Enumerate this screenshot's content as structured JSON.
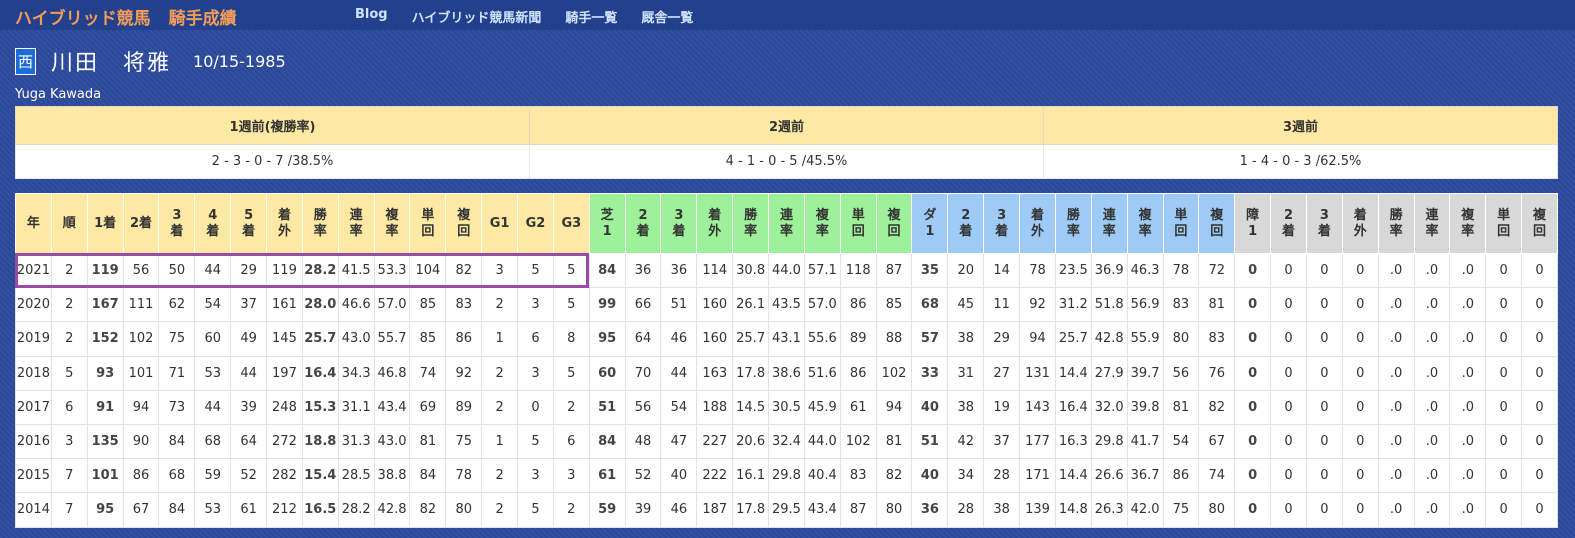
{
  "header": {
    "brand": "ハイブリッド競馬",
    "brand_sub": "騎手成績",
    "nav": [
      "Blog",
      "ハイブリッド競馬新聞",
      "騎手一覧",
      "厩舎一覧"
    ]
  },
  "jockey": {
    "region": "西",
    "name": "川田　将雅",
    "birth": "10/15-1985",
    "roman": "Yuga Kawada"
  },
  "weekly": {
    "headers": [
      "1週前(複勝率)",
      "2週前",
      "3週前"
    ],
    "values": [
      "2 - 3 - 0 - 7 /38.5%",
      "4 - 1 - 0 - 5 /45.5%",
      "1 - 4 - 0 - 3 /62.5%"
    ]
  },
  "stats": {
    "columns": [
      [
        "年",
        "",
        "y"
      ],
      [
        "順",
        "",
        "y"
      ],
      [
        "1着",
        "",
        "y"
      ],
      [
        "2着",
        "",
        "y"
      ],
      [
        "3",
        "着",
        "y"
      ],
      [
        "4",
        "着",
        "y"
      ],
      [
        "5",
        "着",
        "y"
      ],
      [
        "着",
        "外",
        "y"
      ],
      [
        "勝",
        "率",
        "y"
      ],
      [
        "連",
        "率",
        "y"
      ],
      [
        "複",
        "率",
        "y"
      ],
      [
        "単",
        "回",
        "y"
      ],
      [
        "複",
        "回",
        "y"
      ],
      [
        "G1",
        "",
        "y"
      ],
      [
        "G2",
        "",
        "y"
      ],
      [
        "G3",
        "",
        "y"
      ],
      [
        "芝",
        "1",
        "g"
      ],
      [
        "2",
        "着",
        "g"
      ],
      [
        "3",
        "着",
        "g"
      ],
      [
        "着",
        "外",
        "g"
      ],
      [
        "勝",
        "率",
        "g"
      ],
      [
        "連",
        "率",
        "g"
      ],
      [
        "複",
        "率",
        "g"
      ],
      [
        "単",
        "回",
        "g"
      ],
      [
        "複",
        "回",
        "g"
      ],
      [
        "ダ",
        "1",
        "b"
      ],
      [
        "2",
        "着",
        "b"
      ],
      [
        "3",
        "着",
        "b"
      ],
      [
        "着",
        "外",
        "b"
      ],
      [
        "勝",
        "率",
        "b"
      ],
      [
        "連",
        "率",
        "b"
      ],
      [
        "複",
        "率",
        "b"
      ],
      [
        "単",
        "回",
        "b"
      ],
      [
        "複",
        "回",
        "b"
      ],
      [
        "障",
        "1",
        "gr"
      ],
      [
        "2",
        "着",
        "gr"
      ],
      [
        "3",
        "着",
        "gr"
      ],
      [
        "着",
        "外",
        "gr"
      ],
      [
        "勝",
        "率",
        "gr"
      ],
      [
        "連",
        "率",
        "gr"
      ],
      [
        "複",
        "率",
        "gr"
      ],
      [
        "単",
        "回",
        "gr"
      ],
      [
        "複",
        "回",
        "gr"
      ]
    ],
    "bold_cols": [
      2,
      8,
      16,
      25,
      34
    ],
    "rows": [
      [
        "2021",
        "2",
        "119",
        "56",
        "50",
        "44",
        "29",
        "119",
        "28.2",
        "41.5",
        "53.3",
        "104",
        "82",
        "3",
        "5",
        "5",
        "84",
        "36",
        "36",
        "114",
        "30.8",
        "44.0",
        "57.1",
        "118",
        "87",
        "35",
        "20",
        "14",
        "78",
        "23.5",
        "36.9",
        "46.3",
        "78",
        "72",
        "0",
        "0",
        "0",
        "0",
        ".0",
        ".0",
        ".0",
        "0",
        "0"
      ],
      [
        "2020",
        "2",
        "167",
        "111",
        "62",
        "54",
        "37",
        "161",
        "28.0",
        "46.6",
        "57.0",
        "85",
        "83",
        "2",
        "3",
        "5",
        "99",
        "66",
        "51",
        "160",
        "26.1",
        "43.5",
        "57.0",
        "86",
        "85",
        "68",
        "45",
        "11",
        "92",
        "31.2",
        "51.8",
        "56.9",
        "83",
        "81",
        "0",
        "0",
        "0",
        "0",
        ".0",
        ".0",
        ".0",
        "0",
        "0"
      ],
      [
        "2019",
        "2",
        "152",
        "102",
        "75",
        "60",
        "49",
        "145",
        "25.7",
        "43.0",
        "55.7",
        "85",
        "86",
        "1",
        "6",
        "8",
        "95",
        "64",
        "46",
        "160",
        "25.7",
        "43.1",
        "55.6",
        "89",
        "88",
        "57",
        "38",
        "29",
        "94",
        "25.7",
        "42.8",
        "55.9",
        "80",
        "83",
        "0",
        "0",
        "0",
        "0",
        ".0",
        ".0",
        ".0",
        "0",
        "0"
      ],
      [
        "2018",
        "5",
        "93",
        "101",
        "71",
        "53",
        "44",
        "197",
        "16.4",
        "34.3",
        "46.8",
        "74",
        "92",
        "2",
        "3",
        "5",
        "60",
        "70",
        "44",
        "163",
        "17.8",
        "38.6",
        "51.6",
        "86",
        "102",
        "33",
        "31",
        "27",
        "131",
        "14.4",
        "27.9",
        "39.7",
        "56",
        "76",
        "0",
        "0",
        "0",
        "0",
        ".0",
        ".0",
        ".0",
        "0",
        "0"
      ],
      [
        "2017",
        "6",
        "91",
        "94",
        "73",
        "44",
        "39",
        "248",
        "15.3",
        "31.1",
        "43.4",
        "69",
        "89",
        "2",
        "0",
        "2",
        "51",
        "56",
        "54",
        "188",
        "14.5",
        "30.5",
        "45.9",
        "61",
        "94",
        "40",
        "38",
        "19",
        "143",
        "16.4",
        "32.0",
        "39.8",
        "81",
        "82",
        "0",
        "0",
        "0",
        "0",
        ".0",
        ".0",
        ".0",
        "0",
        "0"
      ],
      [
        "2016",
        "3",
        "135",
        "90",
        "84",
        "68",
        "64",
        "272",
        "18.8",
        "31.3",
        "43.0",
        "81",
        "75",
        "1",
        "5",
        "6",
        "84",
        "48",
        "47",
        "227",
        "20.6",
        "32.4",
        "44.0",
        "102",
        "81",
        "51",
        "42",
        "37",
        "177",
        "16.3",
        "29.8",
        "41.7",
        "54",
        "67",
        "0",
        "0",
        "0",
        "0",
        ".0",
        ".0",
        ".0",
        "0",
        "0"
      ],
      [
        "2015",
        "7",
        "101",
        "86",
        "68",
        "59",
        "52",
        "282",
        "15.4",
        "28.5",
        "38.8",
        "84",
        "78",
        "2",
        "3",
        "3",
        "61",
        "52",
        "40",
        "222",
        "16.1",
        "29.8",
        "40.4",
        "83",
        "82",
        "40",
        "34",
        "28",
        "171",
        "14.4",
        "26.6",
        "36.7",
        "86",
        "74",
        "0",
        "0",
        "0",
        "0",
        ".0",
        ".0",
        ".0",
        "0",
        "0"
      ],
      [
        "2014",
        "7",
        "95",
        "67",
        "84",
        "53",
        "61",
        "212",
        "16.5",
        "28.2",
        "42.8",
        "82",
        "80",
        "2",
        "5",
        "2",
        "59",
        "39",
        "46",
        "187",
        "17.8",
        "29.5",
        "43.4",
        "87",
        "80",
        "36",
        "28",
        "38",
        "139",
        "14.8",
        "26.3",
        "42.0",
        "75",
        "80",
        "0",
        "0",
        "0",
        "0",
        ".0",
        ".0",
        ".0",
        "0",
        "0"
      ]
    ]
  }
}
